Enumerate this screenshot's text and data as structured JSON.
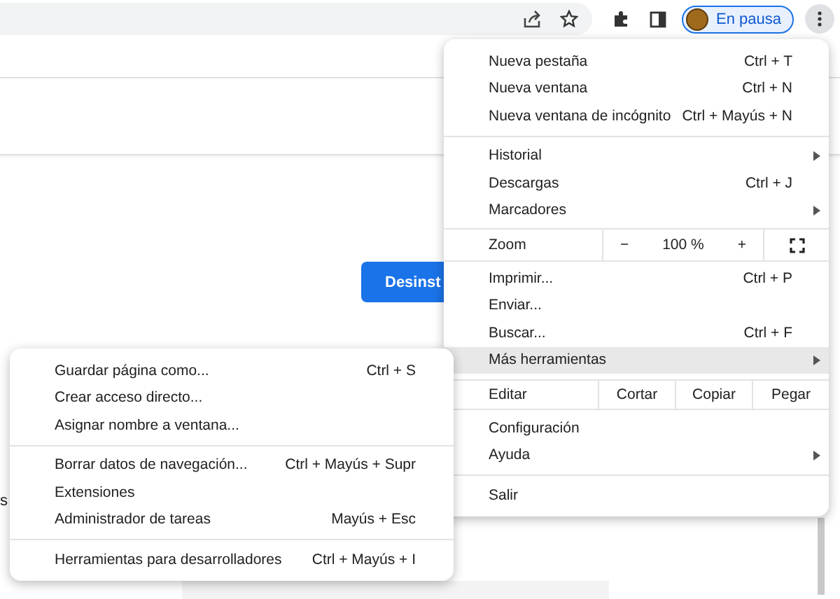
{
  "toolbar": {
    "profile_label": "En pausa"
  },
  "page": {
    "button": "Desinst",
    "fragment": "s"
  },
  "menu": {
    "items": [
      {
        "kind": "item",
        "label": "Nueva pestaña",
        "shortcut": "Ctrl + T",
        "has_submenu": false,
        "highlighted": false
      },
      {
        "kind": "item",
        "label": "Nueva ventana",
        "shortcut": "Ctrl + N",
        "has_submenu": false,
        "highlighted": false
      },
      {
        "kind": "item",
        "label": "Nueva ventana de incógnito",
        "shortcut": "Ctrl + Mayús + N",
        "has_submenu": false,
        "highlighted": false
      },
      {
        "kind": "divider"
      },
      {
        "kind": "item",
        "label": "Historial",
        "has_submenu": true,
        "highlighted": false
      },
      {
        "kind": "item",
        "label": "Descargas",
        "shortcut": "Ctrl + J",
        "has_submenu": false,
        "highlighted": false
      },
      {
        "kind": "item",
        "label": "Marcadores",
        "has_submenu": true,
        "highlighted": false
      },
      {
        "kind": "zoom",
        "label": "Zoom",
        "minus": "−",
        "value": "100 %",
        "plus": "+"
      },
      {
        "kind": "item",
        "label": "Imprimir...",
        "shortcut": "Ctrl + P",
        "has_submenu": false,
        "highlighted": false
      },
      {
        "kind": "item",
        "label": "Enviar...",
        "has_submenu": false,
        "highlighted": false
      },
      {
        "kind": "item",
        "label": "Buscar...",
        "shortcut": "Ctrl + F",
        "has_submenu": false,
        "highlighted": false
      },
      {
        "kind": "item",
        "label": "Más herramientas",
        "has_submenu": true,
        "highlighted": true
      },
      {
        "kind": "edit",
        "label": "Editar",
        "actions": [
          "Cortar",
          "Copiar",
          "Pegar"
        ]
      },
      {
        "kind": "item",
        "label": "Configuración",
        "has_submenu": false,
        "highlighted": false
      },
      {
        "kind": "item",
        "label": "Ayuda",
        "has_submenu": true,
        "highlighted": false
      },
      {
        "kind": "divider"
      },
      {
        "kind": "item",
        "label": "Salir",
        "has_submenu": false,
        "highlighted": false
      }
    ]
  },
  "submenu": {
    "items": [
      {
        "kind": "item",
        "label": "Guardar página como...",
        "shortcut": "Ctrl + S",
        "has_submenu": false,
        "highlighted": false
      },
      {
        "kind": "item",
        "label": "Crear acceso directo...",
        "has_submenu": false,
        "highlighted": false
      },
      {
        "kind": "item",
        "label": "Asignar nombre a ventana...",
        "has_submenu": false,
        "highlighted": false
      },
      {
        "kind": "divider"
      },
      {
        "kind": "item",
        "label": "Borrar datos de navegación...",
        "shortcut": "Ctrl + Mayús + Supr",
        "has_submenu": false,
        "highlighted": false
      },
      {
        "kind": "item",
        "label": "Extensiones",
        "has_submenu": false,
        "highlighted": false
      },
      {
        "kind": "item",
        "label": "Administrador de tareas",
        "shortcut": "Mayús + Esc",
        "has_submenu": false,
        "highlighted": false
      },
      {
        "kind": "divider"
      },
      {
        "kind": "item",
        "label": "Herramientas para desarrolladores",
        "shortcut": "Ctrl + Mayús + I",
        "has_submenu": false,
        "highlighted": false
      }
    ]
  }
}
